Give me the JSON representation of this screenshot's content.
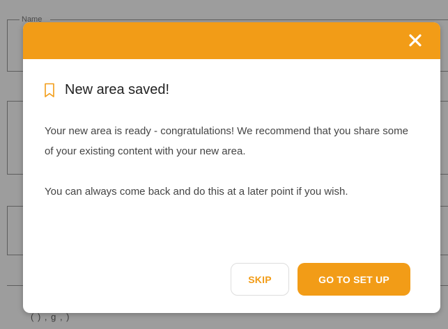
{
  "background": {
    "field_legend": "Name",
    "bottom_text": "(        )       ,         g ,        )"
  },
  "modal": {
    "title": "New area saved!",
    "paragraph1": "Your new area is ready - congratulations! We recommend that you share some of your existing content with your new area.",
    "paragraph2": "You can always come back and do this at a later point if you wish.",
    "skip_label": "SKIP",
    "go_label": "GO TO SET UP",
    "close_icon": "close-icon",
    "title_icon": "bookmark-icon"
  },
  "colors": {
    "accent": "#f29c17",
    "overlay": "#9d9d9d"
  }
}
